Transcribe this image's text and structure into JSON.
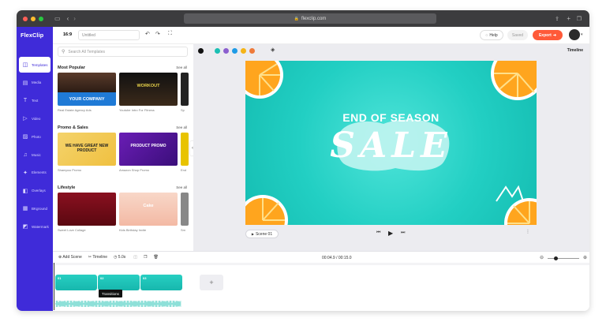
{
  "browser": {
    "url": "flexclip.com"
  },
  "app": {
    "logo": "FlexClip",
    "ratio": "16:9",
    "project_title": "Untitled",
    "help": "Help",
    "saved": "Saved",
    "export": "Export",
    "timeline_link": "Timeline",
    "accent": "#3f2bd9",
    "export_color": "#ff5a39"
  },
  "sidebar": {
    "items": [
      {
        "label": "Templates",
        "icon": "templates-icon"
      },
      {
        "label": "Media",
        "icon": "media-icon"
      },
      {
        "label": "Text",
        "icon": "text-icon"
      },
      {
        "label": "Video",
        "icon": "video-icon"
      },
      {
        "label": "Photo",
        "icon": "photo-icon"
      },
      {
        "label": "Music",
        "icon": "music-icon"
      },
      {
        "label": "Elements",
        "icon": "elements-icon"
      },
      {
        "label": "Overlays",
        "icon": "overlays-icon"
      },
      {
        "label": "BKground",
        "icon": "background-icon"
      },
      {
        "label": "Watermark",
        "icon": "watermark-icon"
      }
    ]
  },
  "panel": {
    "search_placeholder": "Search All Templates",
    "sections": [
      {
        "title": "Most Popular",
        "see_all": "See all",
        "items": [
          {
            "caption": "Real Estate Agency Ads",
            "overlay": "YOUR COMPANY"
          },
          {
            "caption": "Youtube Intro For Fitness",
            "overlay": "WORKOUT"
          },
          {
            "caption": "Sp"
          }
        ]
      },
      {
        "title": "Promo & Sales",
        "see_all": "See all",
        "items": [
          {
            "caption": "Shampoo Promo",
            "overlay": "WE HAVE GREAT NEW PRODUCT"
          },
          {
            "caption": "Amazon Shop Promo",
            "overlay": "PRODUCT PROMO"
          },
          {
            "caption": "End"
          }
        ]
      },
      {
        "title": "Lifestyle",
        "see_all": "See all",
        "items": [
          {
            "caption": "Sweet Love Collage",
            "overlay": ""
          },
          {
            "caption": "Kids Birthday Invite",
            "overlay": "Cake"
          },
          {
            "caption": "Sm"
          }
        ]
      }
    ]
  },
  "canvas": {
    "headline": "END OF SEASON",
    "sale": "SALE",
    "scene_label": "Scene 01"
  },
  "palette": [
    "#111111",
    "#1bbfb3",
    "#8b5fcf",
    "#1e9be6",
    "#f5b417",
    "#ee7a3a"
  ],
  "timeline": {
    "add_scene": "Add Scene",
    "timeline": "Timeline",
    "duration": "5.0s",
    "time": "00:04.9 / 00:15.0",
    "tooltip": "Transitions",
    "clips": [
      "01",
      "02",
      "03"
    ],
    "add": "+"
  }
}
